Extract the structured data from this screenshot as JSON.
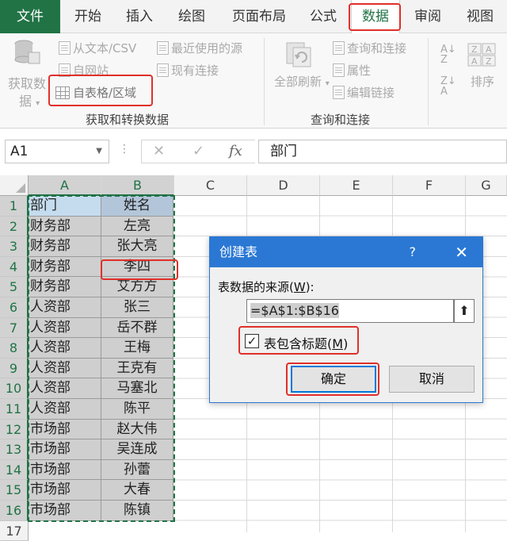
{
  "ribbon_tabs": [
    "文件",
    "开始",
    "插入",
    "绘图",
    "页面布局",
    "公式",
    "数据",
    "审阅",
    "视图"
  ],
  "ribbon": {
    "get_data_line1": "获取数",
    "get_data_line2": "据",
    "from_text": "从文本/CSV",
    "from_web": "自网站",
    "from_table": "自表格/区域",
    "recent_sources": "最近使用的源",
    "existing_connections": "现有连接",
    "refresh_all": "全部刷新",
    "queries_connections": "查询和连接",
    "properties": "属性",
    "edit_links": "编辑链接",
    "sort": "排序",
    "group_get_transform": "获取和转换数据",
    "group_queries": "查询和连接"
  },
  "formula_bar": {
    "name_box": "A1",
    "fx": "fx",
    "content": "部门"
  },
  "columns": [
    "A",
    "B",
    "C",
    "D",
    "E",
    "F",
    "G"
  ],
  "rows": [
    {
      "n": "1",
      "a": "部门",
      "b": "姓名"
    },
    {
      "n": "2",
      "a": "财务部",
      "b": "左亮"
    },
    {
      "n": "3",
      "a": "财务部",
      "b": "张大亮"
    },
    {
      "n": "4",
      "a": "财务部",
      "b": "李四"
    },
    {
      "n": "5",
      "a": "财务部",
      "b": "艾方方"
    },
    {
      "n": "6",
      "a": "人资部",
      "b": "张三"
    },
    {
      "n": "7",
      "a": "人资部",
      "b": "岳不群"
    },
    {
      "n": "8",
      "a": "人资部",
      "b": "王梅"
    },
    {
      "n": "9",
      "a": "人资部",
      "b": "王克有"
    },
    {
      "n": "10",
      "a": "人资部",
      "b": "马塞北"
    },
    {
      "n": "11",
      "a": "人资部",
      "b": "陈平"
    },
    {
      "n": "12",
      "a": "市场部",
      "b": "赵大伟"
    },
    {
      "n": "13",
      "a": "市场部",
      "b": "吴连成"
    },
    {
      "n": "14",
      "a": "市场部",
      "b": "孙蕾"
    },
    {
      "n": "15",
      "a": "市场部",
      "b": "大春"
    },
    {
      "n": "16",
      "a": "市场部",
      "b": "陈镇"
    }
  ],
  "next_row": "17",
  "dialog": {
    "title": "创建表",
    "help": "?",
    "source_label": "表数据的来源(",
    "source_key": "W",
    "source_label_end": "):",
    "source_value": "=$A$1:$B$16",
    "has_headers_label": "表包含标题(",
    "has_headers_key": "M",
    "has_headers_end": ")",
    "has_headers_checked": "✓",
    "ok": "确定",
    "cancel": "取消"
  },
  "colors": {
    "excel_green": "#217346",
    "highlight_red": "#e0302a",
    "dialog_blue": "#2b78d4"
  }
}
